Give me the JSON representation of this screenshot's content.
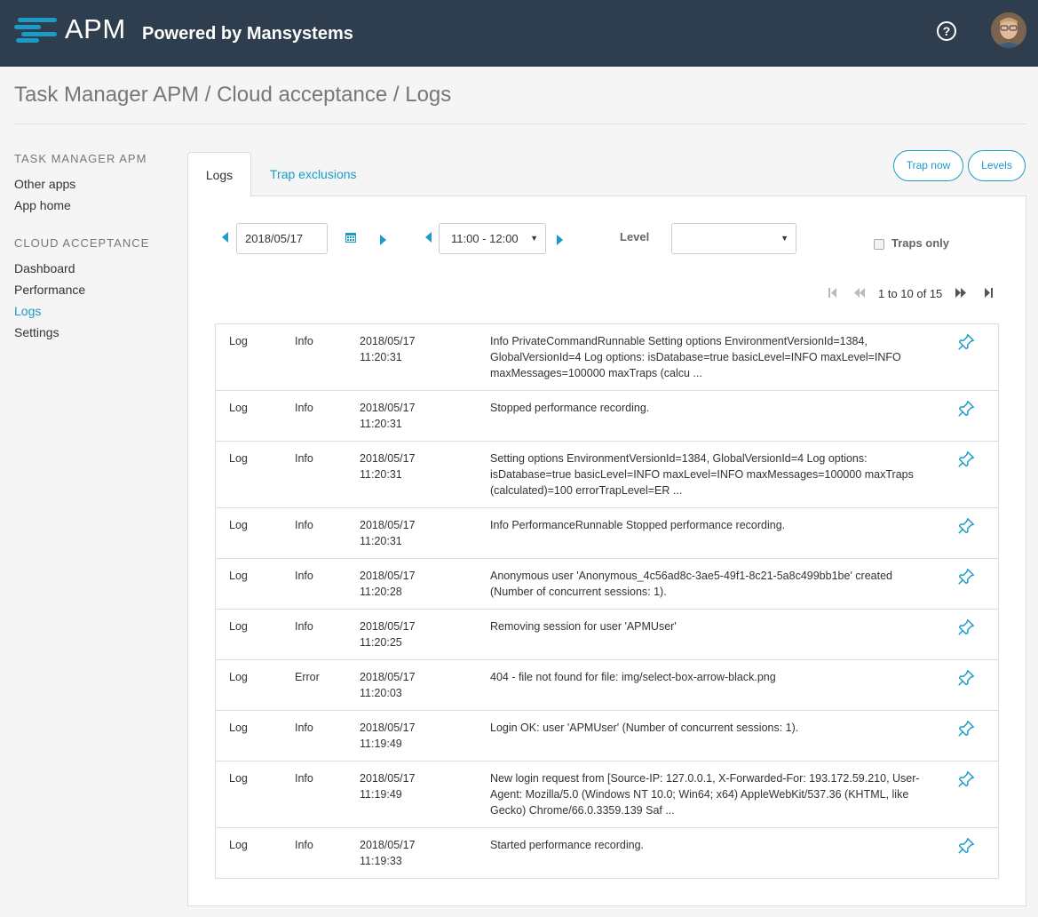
{
  "header": {
    "logo_text": "APM",
    "logo_subtitle": "Powered by Mansystems",
    "help_label": "?",
    "brand_color": "#2f3e4e",
    "accent_color": "#1a9bc8"
  },
  "breadcrumb": "Task Manager APM / Cloud acceptance / Logs",
  "sidebar": {
    "section1_title": "TASK MANAGER APM",
    "section1_items": [
      "Other apps",
      "App home"
    ],
    "section2_title": "CLOUD ACCEPTANCE",
    "section2_items": [
      "Dashboard",
      "Performance",
      "Logs",
      "Settings"
    ],
    "active_item": "Logs"
  },
  "tabs": {
    "logs": "Logs",
    "trap_exclusions": "Trap exclusions",
    "active": "Logs"
  },
  "actions": {
    "trap_now": "Trap now",
    "levels": "Levels"
  },
  "filters": {
    "date": "2018/05/17",
    "time_range": "11:00 - 12:00",
    "level_label": "Level",
    "level_value": "",
    "traps_only_label": "Traps only",
    "traps_only_checked": false
  },
  "pager": {
    "text": "1 to 10 of 15"
  },
  "logs": [
    {
      "type": "Log",
      "level": "Info",
      "date": "2018/05/17",
      "time": "11:20:31",
      "message": "Info PrivateCommandRunnable Setting options EnvironmentVersionId=1384, GlobalVersionId=4 Log options: isDatabase=true basicLevel=INFO maxLevel=INFO maxMessages=100000 maxTraps (calcu ..."
    },
    {
      "type": "Log",
      "level": "Info",
      "date": "2018/05/17",
      "time": "11:20:31",
      "message": "Stopped performance recording."
    },
    {
      "type": "Log",
      "level": "Info",
      "date": "2018/05/17",
      "time": "11:20:31",
      "message": "Setting options EnvironmentVersionId=1384, GlobalVersionId=4 Log options: isDatabase=true basicLevel=INFO maxLevel=INFO maxMessages=100000 maxTraps (calculated)=100 errorTrapLevel=ER ..."
    },
    {
      "type": "Log",
      "level": "Info",
      "date": "2018/05/17",
      "time": "11:20:31",
      "message": "Info PerformanceRunnable Stopped performance recording."
    },
    {
      "type": "Log",
      "level": "Info",
      "date": "2018/05/17",
      "time": "11:20:28",
      "message": "Anonymous user 'Anonymous_4c56ad8c-3ae5-49f1-8c21-5a8c499bb1be' created (Number of concurrent sessions: 1)."
    },
    {
      "type": "Log",
      "level": "Info",
      "date": "2018/05/17",
      "time": "11:20:25",
      "message": "Removing session for user 'APMUser'"
    },
    {
      "type": "Log",
      "level": "Error",
      "date": "2018/05/17",
      "time": "11:20:03",
      "message": "404 - file not found for file: img/select-box-arrow-black.png"
    },
    {
      "type": "Log",
      "level": "Info",
      "date": "2018/05/17",
      "time": "11:19:49",
      "message": "Login OK: user 'APMUser' (Number of concurrent sessions: 1)."
    },
    {
      "type": "Log",
      "level": "Info",
      "date": "2018/05/17",
      "time": "11:19:49",
      "message": "New login request from [Source-IP: 127.0.0.1, X-Forwarded-For: 193.172.59.210, User-Agent: Mozilla/5.0 (Windows NT 10.0; Win64; x64) AppleWebKit/537.36 (KHTML, like Gecko) Chrome/66.0.3359.139 Saf ..."
    },
    {
      "type": "Log",
      "level": "Info",
      "date": "2018/05/17",
      "time": "11:19:33",
      "message": "Started performance recording."
    }
  ]
}
